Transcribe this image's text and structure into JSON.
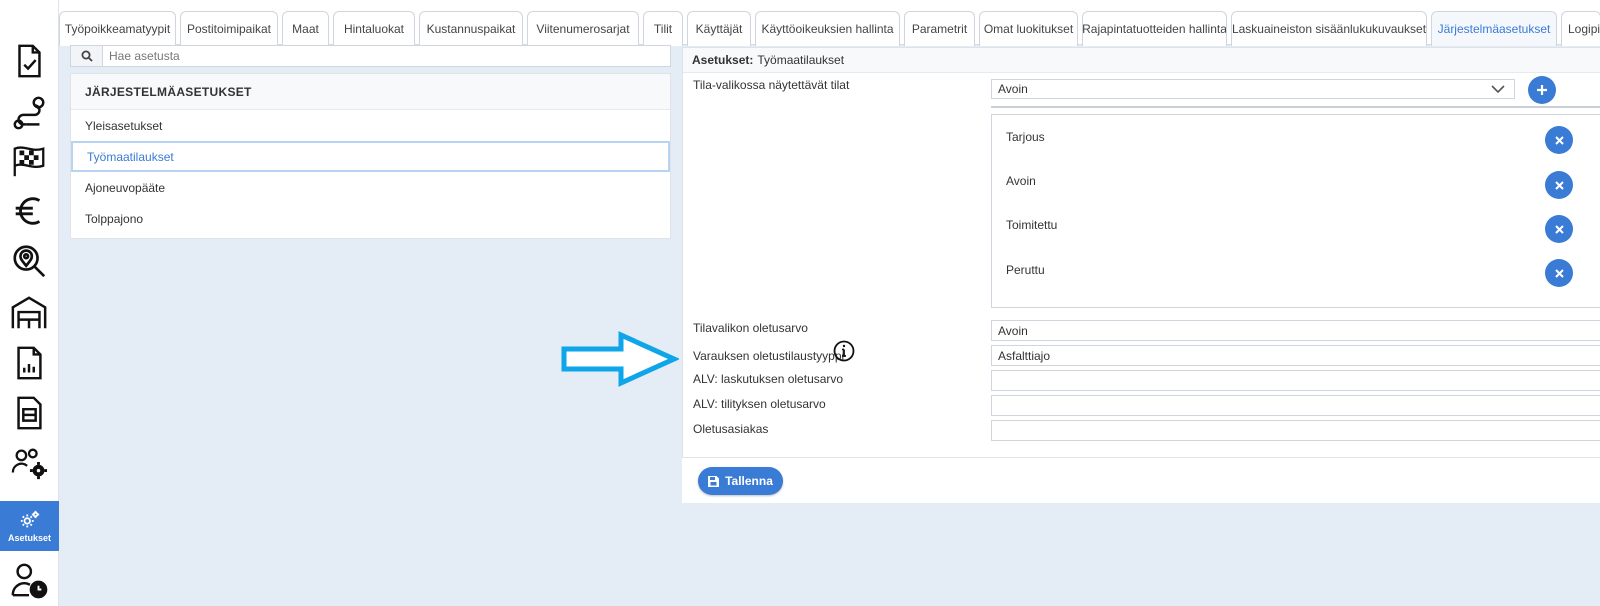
{
  "sidebar": {
    "active_label": "Asetukset",
    "icons": [
      "tasks-icon",
      "route-icon",
      "finish-flag-icon",
      "euro-icon",
      "map-search-icon",
      "warehouse-icon",
      "report-icon",
      "document-icon",
      "users-settings-icon",
      "settings-icon",
      "user-clock-icon"
    ]
  },
  "tabs": [
    {
      "label": "Työpoikkeamatyypit"
    },
    {
      "label": "Postitoimipaikat"
    },
    {
      "label": "Maat"
    },
    {
      "label": "Hintaluokat"
    },
    {
      "label": "Kustannuspaikat"
    },
    {
      "label": "Viitenumerosarjat"
    },
    {
      "label": "Tilit"
    },
    {
      "label": "Käyttäjät"
    },
    {
      "label": "Käyttöoikeuksien hallinta"
    },
    {
      "label": "Parametrit"
    },
    {
      "label": "Omat luokitukset"
    },
    {
      "label": "Rajapintatuotteiden hallinta"
    },
    {
      "label": "Laskuaineiston sisäänlukukuvaukset"
    },
    {
      "label": "Järjestelmäasetukset",
      "active": true
    },
    {
      "label": "Logipi"
    }
  ],
  "search": {
    "placeholder": "Hae asetusta",
    "value": ""
  },
  "settings_list": {
    "header": "JÄRJESTELMÄASETUKSET",
    "items": [
      {
        "label": "Yleisasetukset"
      },
      {
        "label": "Työmaatilaukset",
        "selected": true
      },
      {
        "label": "Ajoneuvopääte"
      },
      {
        "label": "Tolppajono"
      }
    ]
  },
  "panel": {
    "title_prefix": "Asetukset:",
    "title_value": "Työmaatilaukset",
    "status_select": {
      "label": "Tila-valikossa näytettävät tilat",
      "selected": "Avoin",
      "items": [
        "Tarjous",
        "Avoin",
        "Toimitettu",
        "Peruttu"
      ]
    },
    "fields": [
      {
        "label": "Tilavalikon oletusarvo",
        "value": "Avoin"
      },
      {
        "label": "Varauksen oletustilaustyyppi",
        "value": "Asfalttiajo"
      },
      {
        "label": "ALV: laskutuksen oletusarvo",
        "value": ""
      },
      {
        "label": "ALV: tilityksen oletusarvo",
        "value": ""
      },
      {
        "label": "Oletusasiakas",
        "value": ""
      }
    ]
  },
  "footer": {
    "save_label": "Tallenna"
  },
  "colors": {
    "accent": "#3a7bd5",
    "annotation_arrow": "#0ea5e9",
    "background": "#e4ecf5"
  }
}
